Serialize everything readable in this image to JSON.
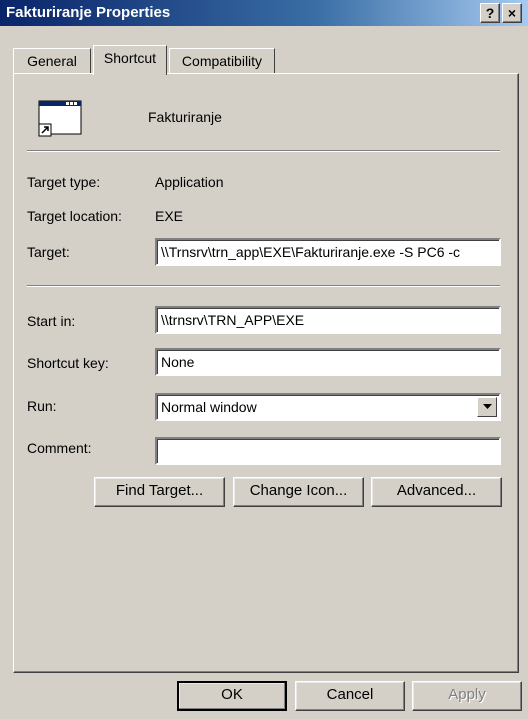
{
  "window": {
    "title": "Fakturiranje Properties",
    "help_label": "?",
    "close_label": "×"
  },
  "tabs": [
    {
      "label": "General"
    },
    {
      "label": "Shortcut"
    },
    {
      "label": "Compatibility"
    }
  ],
  "shortcut": {
    "name": "Fakturiranje",
    "target_type_label": "Target type:",
    "target_type_value": "Application",
    "target_location_label": "Target location:",
    "target_location_value": "EXE",
    "target_label": "Target:",
    "target_value": "\\\\Trnsrv\\trn_app\\EXE\\Fakturiranje.exe -S PC6 -c",
    "start_in_label": "Start in:",
    "start_in_value": "\\\\trnsrv\\TRN_APP\\EXE",
    "shortcut_key_label": "Shortcut key:",
    "shortcut_key_value": "None",
    "run_label": "Run:",
    "run_value": "Normal window",
    "comment_label": "Comment:",
    "comment_value": "",
    "find_target_label": "Find Target...",
    "change_icon_label": "Change Icon...",
    "advanced_label": "Advanced..."
  },
  "footer": {
    "ok_label": "OK",
    "cancel_label": "Cancel",
    "apply_label": "Apply"
  }
}
